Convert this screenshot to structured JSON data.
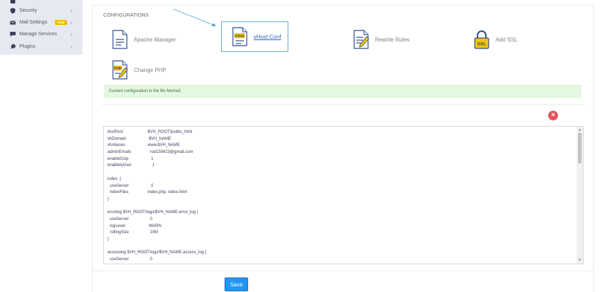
{
  "sidebar": {
    "items": [
      {
        "label": "Security",
        "icon": "shield-icon"
      },
      {
        "label": "Mail Settings",
        "icon": "mail-icon",
        "badge": "NEW"
      },
      {
        "label": "Manage Services",
        "icon": "chat-icon"
      },
      {
        "label": "Plugins",
        "icon": "plug-icon"
      }
    ]
  },
  "configurations": {
    "title": "CONFIGURATIONS",
    "items": [
      {
        "label": "Apache Manager",
        "icon": "apache-file-icon"
      },
      {
        "label": "vHost Conf",
        "icon": "vhost-file-icon",
        "active": true
      },
      {
        "label": "Rewrite Rules",
        "icon": "rewrite-file-icon"
      },
      {
        "label": "Add SSL",
        "icon": "ssl-lock-icon"
      },
      {
        "label": "Change PHP",
        "icon": "php-file-icon"
      }
    ]
  },
  "alert": {
    "text": "Current configuration in the file fetched."
  },
  "editor": {
    "lines": [
      {
        "k": "docRoot",
        "v": "$VH_ROOT/public_html"
      },
      {
        "k": "vhDomain",
        "v": " $VH_NAME"
      },
      {
        "k": "vhAliases",
        "v": "www.$VH_NAME"
      },
      {
        "k": "adminEmails",
        "v": "  rod150623@gmail.com"
      },
      {
        "k": "enableGzip",
        "v": "   1"
      },
      {
        "k": "enableIpGeo",
        "v": "    1"
      },
      {
        "k": "",
        "v": ""
      },
      {
        "k": "index  {",
        "v": ""
      },
      {
        "k": "  useServer",
        "v": "   0"
      },
      {
        "k": "  indexFiles",
        "v": "index.php, index.html"
      },
      {
        "k": "}",
        "v": ""
      },
      {
        "k": "",
        "v": ""
      },
      {
        "k": "errorlog $VH_ROOT/logs/$VH_NAME.error_log {",
        "v": ""
      },
      {
        "k": "  useServer",
        "v": "  0"
      },
      {
        "k": "  logLevel",
        "v": " WARN"
      },
      {
        "k": "  rollingSize",
        "v": "  10M"
      },
      {
        "k": "}",
        "v": ""
      },
      {
        "k": "",
        "v": ""
      },
      {
        "k": "accesslog $VH_ROOT/logs/$VH_NAME.access_log {",
        "v": ""
      },
      {
        "k": "  useServer",
        "v": "  0"
      }
    ]
  },
  "footer": {
    "save_label": "Save"
  },
  "colors": {
    "accent": "#2196f3",
    "danger": "#e7515a",
    "success_bg": "#e4f8e2"
  }
}
